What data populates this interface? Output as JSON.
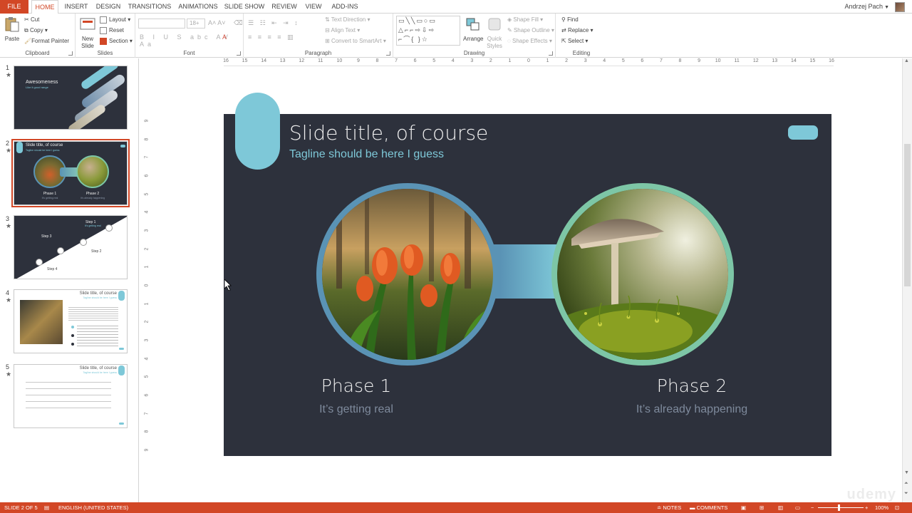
{
  "tabs": {
    "file": "FILE",
    "items": [
      "HOME",
      "INSERT",
      "DESIGN",
      "TRANSITIONS",
      "ANIMATIONS",
      "SLIDE SHOW",
      "REVIEW",
      "VIEW",
      "ADD-INS"
    ],
    "active": "HOME"
  },
  "user": {
    "name": "Andrzej Pach"
  },
  "ribbon": {
    "clipboard": {
      "label": "Clipboard",
      "paste": "Paste",
      "cut": "Cut",
      "copy": "Copy",
      "format_painter": "Format Painter"
    },
    "slides": {
      "label": "Slides",
      "new_slide": "New Slide",
      "layout": "Layout",
      "reset": "Reset",
      "section": "Section"
    },
    "font": {
      "label": "Font",
      "size": "18+"
    },
    "paragraph": {
      "label": "Paragraph",
      "text_direction": "Text Direction",
      "align_text": "Align Text",
      "convert": "Convert to SmartArt"
    },
    "drawing": {
      "label": "Drawing",
      "arrange": "Arrange",
      "quick_styles": "Quick Styles",
      "shape_fill": "Shape Fill",
      "shape_outline": "Shape Outline",
      "shape_effects": "Shape Effects"
    },
    "editing": {
      "label": "Editing",
      "find": "Find",
      "replace": "Replace",
      "select": "Select"
    }
  },
  "ruler": {
    "h_ticks": [
      "16",
      "15",
      "14",
      "13",
      "12",
      "11",
      "10",
      "9",
      "8",
      "7",
      "6",
      "5",
      "4",
      "3",
      "2",
      "1",
      "0",
      "1",
      "2",
      "3",
      "4",
      "5",
      "6",
      "7",
      "8",
      "9",
      "10",
      "11",
      "12",
      "13",
      "14",
      "15",
      "16"
    ],
    "v_ticks": [
      "9",
      "8",
      "7",
      "6",
      "5",
      "4",
      "3",
      "2",
      "1",
      "0",
      "1",
      "2",
      "3",
      "4",
      "5",
      "6",
      "7",
      "8",
      "9"
    ]
  },
  "thumbnails": [
    {
      "num": "1",
      "star": "★",
      "title": "Awesomeness",
      "subtitle": "Like it good range"
    },
    {
      "num": "2",
      "star": "★",
      "title": "Slide title, of course",
      "subtitle": "Tagline should be here I guess",
      "phase1": "Phase 1",
      "phase1_sub": "It's getting real",
      "phase2": "Phase 2",
      "phase2_sub": "It's already happening"
    },
    {
      "num": "3",
      "star": "★",
      "step1": "Step 1",
      "step2": "Step 2",
      "step3": "Step 3",
      "step4": "Step 4",
      "step_sub": "It's getting real"
    },
    {
      "num": "4",
      "star": "★",
      "title": "Slide title, of course",
      "subtitle": "Tagline should be here I guess"
    },
    {
      "num": "5",
      "star": "★",
      "title": "Slide title, of course",
      "subtitle": "Tagline should be here I guess"
    }
  ],
  "slide": {
    "title": "Slide title, of course",
    "tagline": "Tagline should be here I guess",
    "phase1": {
      "title": "Phase 1",
      "subtitle": "It’s getting real"
    },
    "phase2": {
      "title": "Phase 2",
      "subtitle": "It’s already happening"
    }
  },
  "status": {
    "slide_of": "SLIDE 2 OF 5",
    "language": "ENGLISH (UNITED STATES)",
    "notes": "NOTES",
    "comments": "COMMENTS",
    "zoom": "100%"
  },
  "watermark": "udemy",
  "colors": {
    "accent": "#d24726",
    "slide_bg": "#2d313c",
    "teal": "#7ec8d8",
    "blue": "#5a93b5",
    "green": "#7dc6a6"
  }
}
